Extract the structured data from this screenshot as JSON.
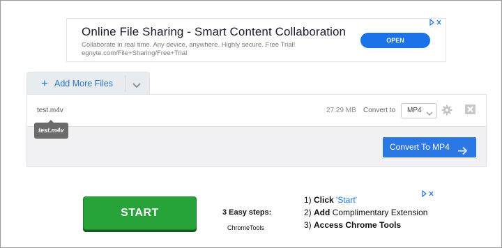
{
  "ad_top": {
    "headline": "Online File Sharing - Smart Content Collaboration",
    "description": "Collaborate in real time. Any device, anywhere. Highly secure. Free Trial! egnyte.com/File+Sharing/Free+Trial",
    "cta": "OPEN",
    "adchoices_icon": "ad-choices-icon"
  },
  "toolbar": {
    "add_files_label": "Add More Files",
    "add_icon": "+"
  },
  "file": {
    "name": "test.m4v",
    "tooltip": "test.m4v",
    "size": "27.29 MB",
    "convert_to_label": "Convert to",
    "format": "MP4"
  },
  "convert_button": {
    "label": "Convert To MP4"
  },
  "ad_bottom": {
    "start_label": "START",
    "steps_title": "3 Easy steps:",
    "brand": "ChromeTools",
    "step1_num": "1)",
    "step1_bold": "Click",
    "step1_rest": "'Start'",
    "step2_num": "2)",
    "step2_bold": "Add",
    "step2_rest": "Complimentary Extension",
    "step3_num": "3)",
    "step3_bold": "Access Chrome Tools"
  },
  "colors": {
    "accent": "#2b78e4",
    "start_green": "#27a33a",
    "ad_blue": "#1a73e8"
  }
}
